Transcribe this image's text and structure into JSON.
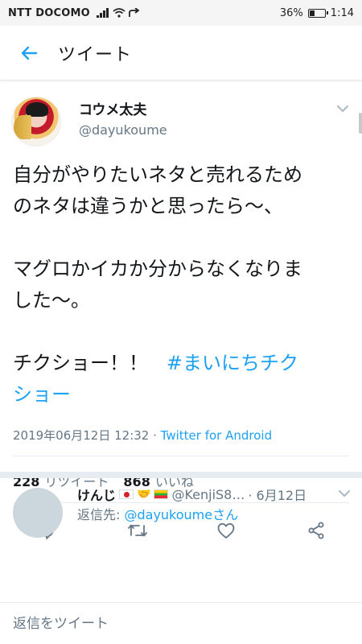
{
  "status_bar": {
    "carrier": "NTT DOCOMO",
    "battery": "36%",
    "battery_level": 0.36,
    "time": "1:14"
  },
  "header": {
    "title": "ツイート"
  },
  "tweet": {
    "author_name": "コウメ太夫",
    "author_handle": "@dayukoume",
    "lines": [
      "自分がやりたいネタと売れるため",
      "のネタは違うかと思ったら〜、",
      "",
      "マグロかイカか分からなくなりま",
      "した〜。",
      "",
      "チクショー！！",
      "ショー"
    ],
    "hashtag": "#まいにちチク",
    "timestamp": "2019年06月12日 12:32 · ",
    "source": "Twitter for Android",
    "retweet_count": "228",
    "retweet_label": "リツイート",
    "like_count": "868",
    "like_label": "いいね"
  },
  "reply": {
    "name": "けんじ",
    "hands": "🤝",
    "handle": "@KenjiS8…",
    "date": "· 6月12日",
    "replying_to_label": "返信先: ",
    "replying_to_handle": "@dayukoumeさん"
  },
  "compose": {
    "placeholder": "返信をツイート"
  },
  "colors": {
    "accent": "#1da1f2",
    "secondary_text": "#657786",
    "divider": "#e6ecf0"
  },
  "icons": [
    "back-arrow-icon",
    "chevron-down-icon",
    "reply-icon",
    "retweet-icon",
    "like-icon",
    "share-icon",
    "signal-icon",
    "wifi-icon"
  ]
}
